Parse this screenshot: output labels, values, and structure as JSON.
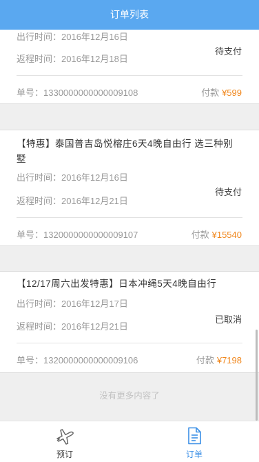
{
  "header": {
    "title": "订单列表"
  },
  "orders": [
    {
      "title": "",
      "depart_label": "出行时间：",
      "depart_date": "2016年12月16日",
      "return_label": "返程时间：",
      "return_date": "2016年12月18日",
      "status": "待支付",
      "order_label": "单号：",
      "order_no": "1330000000000009108",
      "pay_label": "付款",
      "amount": "¥599"
    },
    {
      "title": "【特惠】泰国普吉岛悦榕庄6天4晚自由行 选三种别墅",
      "depart_label": "出行时间：",
      "depart_date": "2016年12月16日",
      "return_label": "返程时间：",
      "return_date": "2016年12月21日",
      "status": "待支付",
      "order_label": "单号：",
      "order_no": "1320000000000009107",
      "pay_label": "付款",
      "amount": "¥15540"
    },
    {
      "title": "【12/17周六出发特惠】日本冲绳5天4晚自由行",
      "depart_label": "出行时间：",
      "depart_date": "2016年12月17日",
      "return_label": "返程时间：",
      "return_date": "2016年12月21日",
      "status": "已取消",
      "order_label": "单号：",
      "order_no": "1320000000000009106",
      "pay_label": "付款",
      "amount": "¥7198"
    }
  ],
  "list_footer": "没有更多内容了",
  "tabbar": {
    "tabs": [
      {
        "label": "预订",
        "icon": "airplane-icon",
        "active": false
      },
      {
        "label": "订单",
        "icon": "document-icon",
        "active": true
      }
    ]
  },
  "colors": {
    "header_bg": "#5aa8f0",
    "accent": "#3b8fe6",
    "amount": "#f08519",
    "muted": "#999999"
  }
}
